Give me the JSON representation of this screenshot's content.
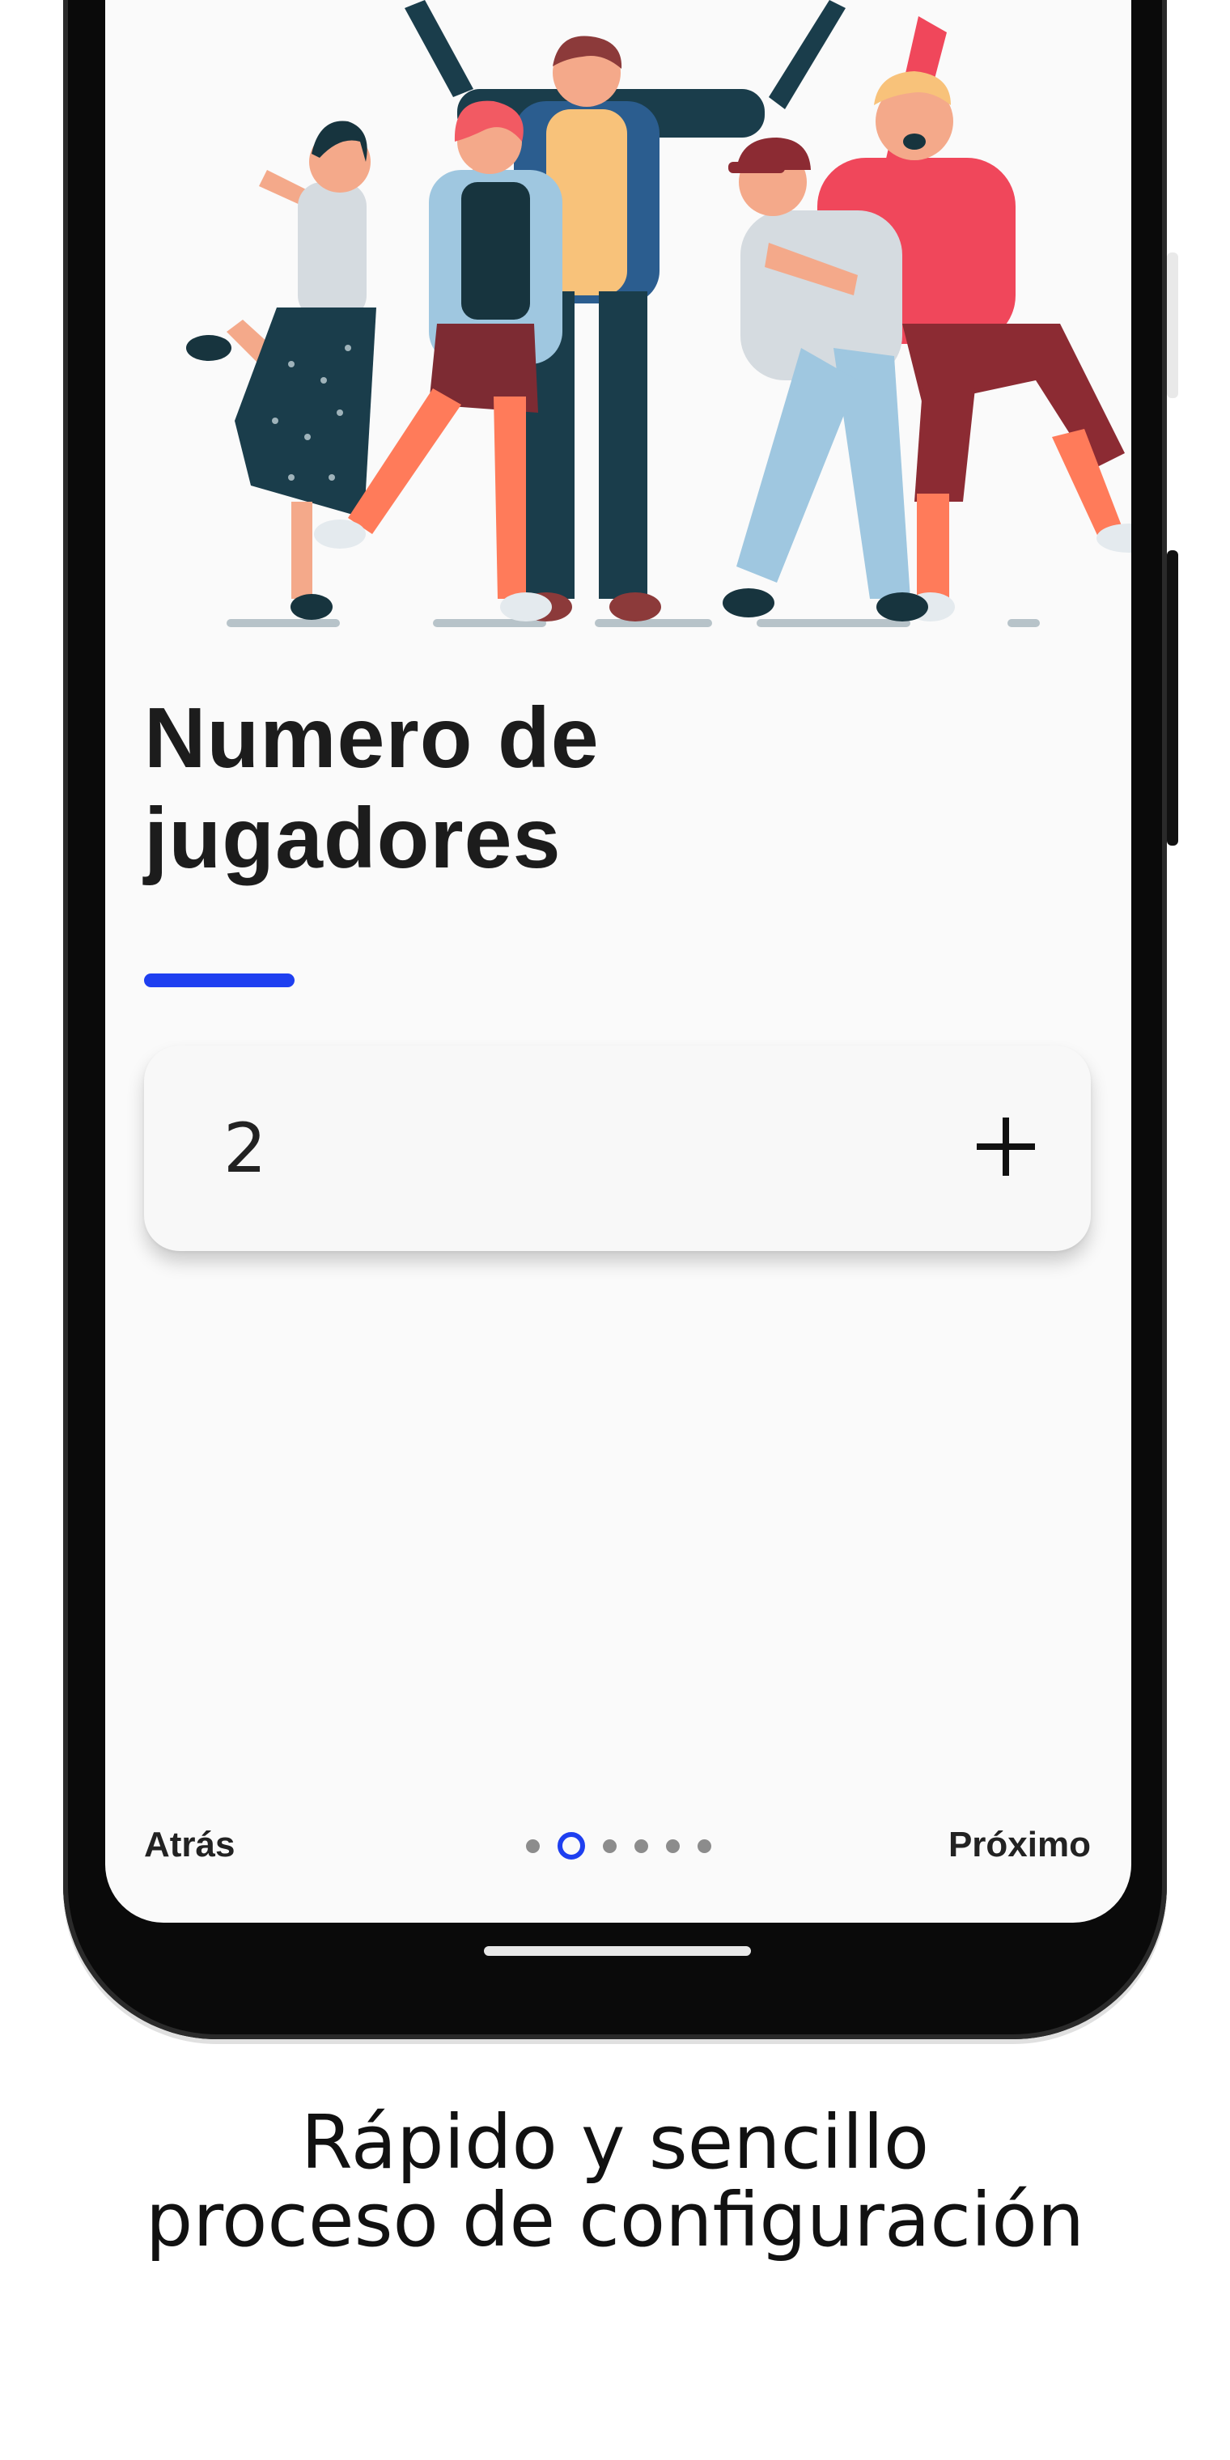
{
  "screen": {
    "title_line1": "Numero de",
    "title_line2": "jugadores",
    "player_count": "2",
    "plus_symbol": "+",
    "accent_color": "#1e3ff0",
    "icons": [
      "friends-illustration",
      "plus-icon"
    ]
  },
  "navigation": {
    "back_label": "Atrás",
    "next_label": "Próximo",
    "page_indicator": {
      "total": 6,
      "current": 2
    }
  },
  "caption": {
    "line1": "Rápido y sencillo",
    "line2": "proceso de configuración"
  }
}
